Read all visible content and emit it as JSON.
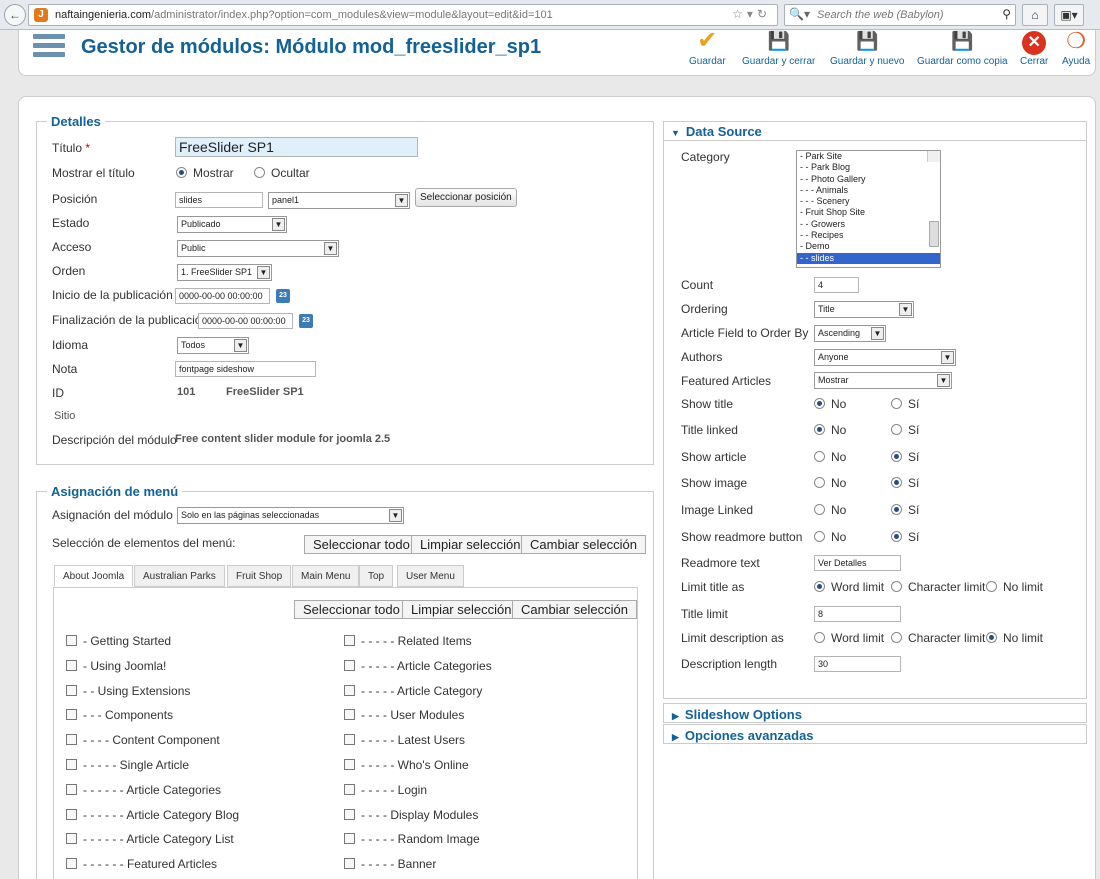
{
  "browser": {
    "url_domain": "naftaingenieria.com",
    "url_path": "/administrator/index.php?option=com_modules&view=module&layout=edit&id=101",
    "search_placeholder": "Search the web (Babylon)"
  },
  "header": {
    "title": "Gestor de módulos: Módulo mod_freeslider_sp1",
    "buttons": {
      "save": "Guardar",
      "save_close": "Guardar y cerrar",
      "save_new": "Guardar y nuevo",
      "save_copy": "Guardar como copia",
      "close": "Cerrar",
      "help": "Ayuda"
    }
  },
  "details": {
    "legend": "Detalles",
    "title_label": "Título",
    "required_mark": "*",
    "title_value": "FreeSlider SP1",
    "show_title_label": "Mostrar el título",
    "show_option": "Mostrar",
    "hide_option": "Ocultar",
    "position_label": "Posición",
    "position_value": "slides",
    "position_select": "panel1",
    "select_position_button": "Seleccionar posición",
    "status_label": "Estado",
    "status_value": "Publicado",
    "access_label": "Acceso",
    "access_value": "Public",
    "order_label": "Orden",
    "order_value": "1. FreeSlider SP1",
    "publish_up_label": "Inicio de la publicación",
    "publish_up_value": "0000-00-00 00:00:00",
    "publish_down_label": "Finalización de la publicación",
    "publish_down_value": "0000-00-00 00:00:00",
    "calendar_glyph": "23",
    "language_label": "Idioma",
    "language_value": "Todos",
    "note_label": "Nota",
    "note_value": "fontpage sideshow",
    "id_label": "ID",
    "id_value": "101",
    "id_name": "FreeSlider SP1",
    "site_label": "Sitio",
    "description_label": "Descripción del módulo",
    "description_value": "Free content slider module for joomla 2.5"
  },
  "menu_assignment": {
    "legend": "Asignación de menú",
    "assignment_label": "Asignación del módulo",
    "assignment_value": "Solo en las páginas seleccionadas",
    "selection_label": "Selección de elementos del menú:",
    "select_all": "Seleccionar todo",
    "clear_selection": "Limpiar selección",
    "toggle_selection": "Cambiar selección",
    "tabs": [
      "About Joomla",
      "Australian Parks",
      "Fruit Shop",
      "Main Menu",
      "Top",
      "User Menu"
    ],
    "left_items": [
      "- Getting Started",
      "- Using Joomla!",
      "- - Using Extensions",
      "- - - Components",
      "- - - - Content Component",
      "- - - - - Single Article",
      "- - - - - - Article Categories",
      "- - - - - - Article Category Blog",
      "- - - - - - Article Category List",
      "- - - - - - Featured Articles"
    ],
    "right_items": [
      "- - - - - Related Items",
      "- - - - - Article Categories",
      "- - - - - Article Category",
      "- - - - User Modules",
      "- - - - - Latest Users",
      "- - - - - Who's Online",
      "- - - - - Login",
      "- - - - Display Modules",
      "- - - - - Random Image",
      "- - - - - Banner"
    ]
  },
  "data_source": {
    "legend": "Data Source",
    "category_label": "Category",
    "categories": [
      "- Park Site",
      "- - Park Blog",
      "- - Photo Gallery",
      "- - - Animals",
      "- - - Scenery",
      "- Fruit Shop Site",
      "- - Growers",
      "- - Recipes",
      "- Demo",
      "- - slides"
    ],
    "count_label": "Count",
    "count_value": "4",
    "ordering_label": "Ordering",
    "ordering_value": "Title",
    "field_order_label": "Article Field to Order By",
    "field_order_value": "Ascending",
    "authors_label": "Authors",
    "authors_value": "Anyone",
    "featured_label": "Featured Articles",
    "featured_value": "Mostrar",
    "no": "No",
    "yes": "Sí",
    "show_title_label": "Show title",
    "title_linked_label": "Title linked",
    "show_article_label": "Show article",
    "show_image_label": "Show image",
    "image_linked_label": "Image Linked",
    "show_readmore_label": "Show readmore button",
    "readmore_text_label": "Readmore text",
    "readmore_text_value": "Ver Detalles",
    "limit_title_label": "Limit title as",
    "word_limit": "Word limit",
    "char_limit": "Character limit",
    "no_limit": "No limit",
    "title_limit_label": "Title limit",
    "title_limit_value": "8",
    "limit_desc_label": "Limit description as",
    "desc_length_label": "Description length",
    "desc_length_value": "30"
  },
  "accordions": {
    "slideshow": "Slideshow Options",
    "advanced": "Opciones avanzadas"
  },
  "colors": {
    "accent": "#146295",
    "save_icon": "#e8a317",
    "close_icon": "#d9331f"
  }
}
